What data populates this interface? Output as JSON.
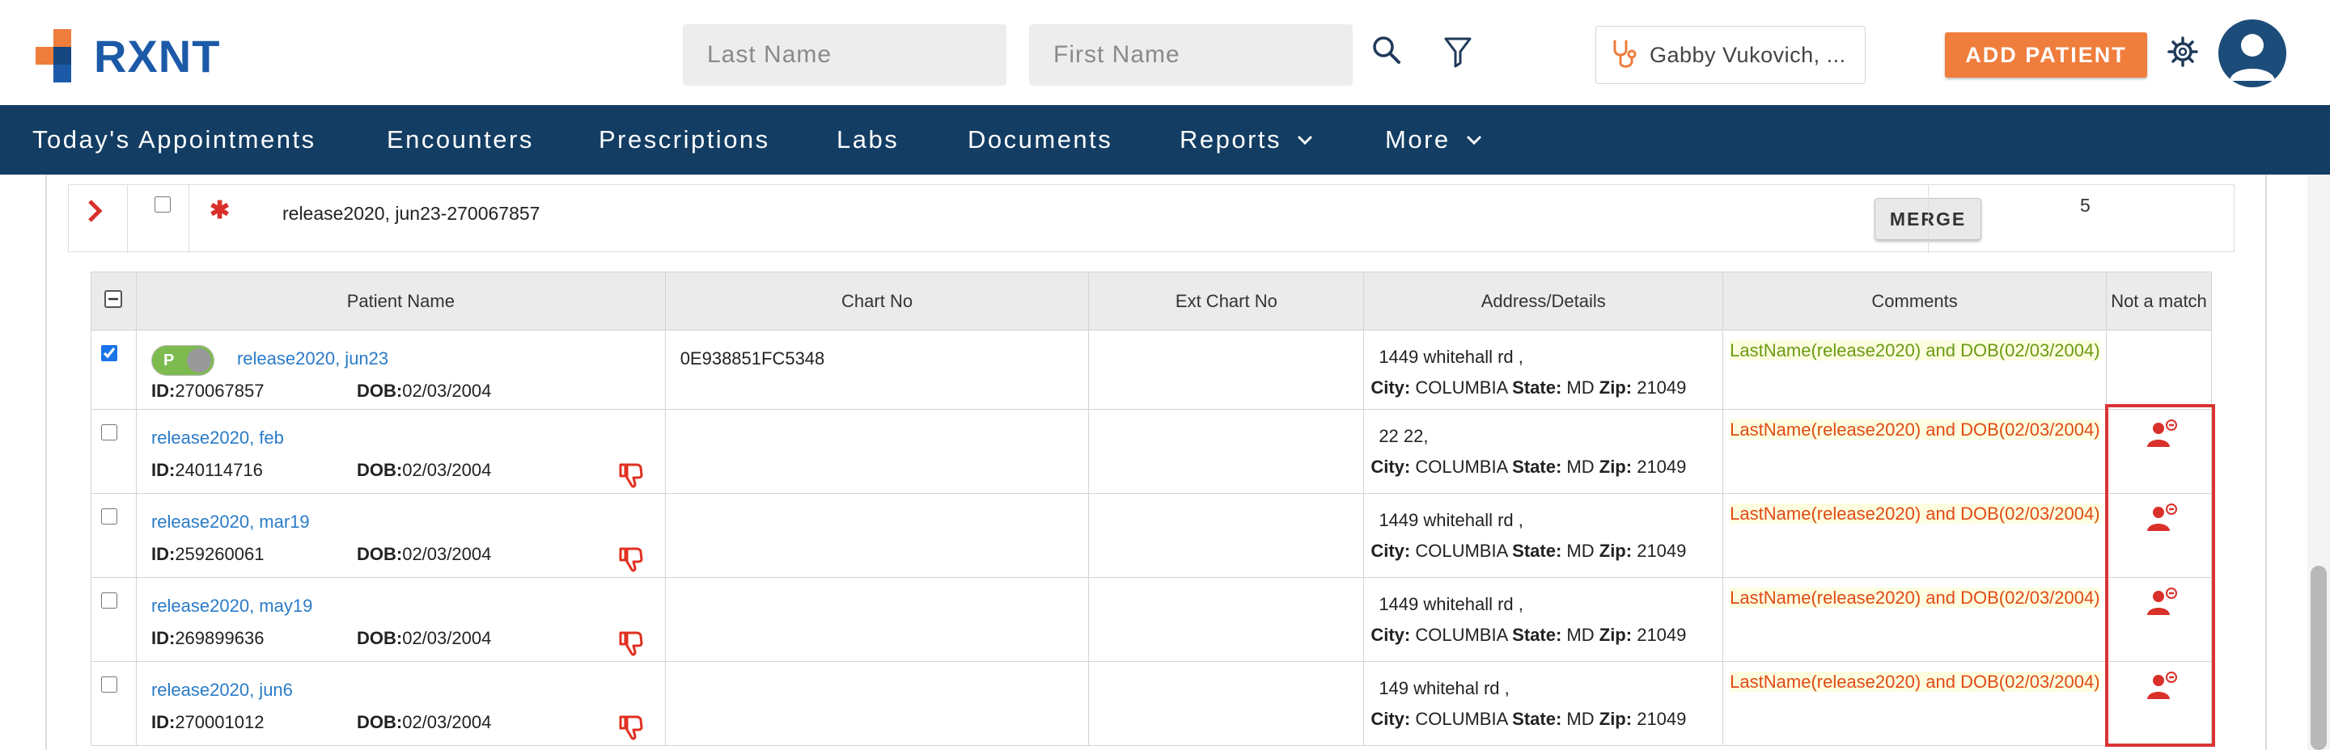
{
  "header": {
    "logo_text": "RXNT",
    "last_name_placeholder": "Last Name",
    "first_name_placeholder": "First Name",
    "provider_name": "Gabby Vukovich, ...",
    "add_patient_label": "ADD PATIENT",
    "icons": [
      "search-icon",
      "filter-icon",
      "stethoscope-icon",
      "gear-icon",
      "user-avatar-icon"
    ]
  },
  "nav": {
    "items": [
      {
        "label": "Today's Appointments"
      },
      {
        "label": "Encounters"
      },
      {
        "label": "Prescriptions"
      },
      {
        "label": "Labs"
      },
      {
        "label": "Documents"
      },
      {
        "label": "Reports"
      },
      {
        "label": "More"
      }
    ]
  },
  "group": {
    "name": "release2020, jun23-270067857",
    "merge_label": "MERGE",
    "count": "5"
  },
  "table": {
    "headers": {
      "patient_name": "Patient Name",
      "chart_no": "Chart No",
      "ext_chart_no": "Ext Chart No",
      "address": "Address/Details",
      "comments": "Comments",
      "not_a_match": "Not a match"
    },
    "labels": {
      "id": "ID:",
      "dob": "DOB:",
      "city": "City:",
      "state": "State:",
      "zip": "Zip:",
      "primary_toggle": "P"
    },
    "rows": [
      {
        "name": "release2020, jun23",
        "id": "270067857",
        "dob": "02/03/2004",
        "chart_no": "0E938851FC5348",
        "ext_chart_no": "",
        "address_line": "1449 whitehall rd ,",
        "city": "COLUMBIA",
        "state": "MD",
        "zip": "21049",
        "comment": "LastName(release2020) and DOB(02/03/2004)",
        "checked": true
      },
      {
        "name": "release2020, feb",
        "id": "240114716",
        "dob": "02/03/2004",
        "chart_no": "",
        "ext_chart_no": "",
        "address_line": "22 22,",
        "city": "COLUMBIA",
        "state": "MD",
        "zip": "21049",
        "comment": "LastName(release2020) and DOB(02/03/2004)",
        "checked": false
      },
      {
        "name": "release2020, mar19",
        "id": "259260061",
        "dob": "02/03/2004",
        "chart_no": "",
        "ext_chart_no": "",
        "address_line": "1449 whitehall rd ,",
        "city": "COLUMBIA",
        "state": "MD",
        "zip": "21049",
        "comment": "LastName(release2020) and DOB(02/03/2004)",
        "checked": false
      },
      {
        "name": "release2020, may19",
        "id": "269899636",
        "dob": "02/03/2004",
        "chart_no": "",
        "ext_chart_no": "",
        "address_line": "1449 whitehall rd ,",
        "city": "COLUMBIA",
        "state": "MD",
        "zip": "21049",
        "comment": "LastName(release2020) and DOB(02/03/2004)",
        "checked": false
      },
      {
        "name": "release2020, jun6",
        "id": "270001012",
        "dob": "02/03/2004",
        "chart_no": "",
        "ext_chart_no": "",
        "address_line": "149 whitehal rd ,",
        "city": "COLUMBIA",
        "state": "MD",
        "zip": "21049",
        "comment": "LastName(release2020) and DOB(02/03/2004)",
        "checked": false
      }
    ]
  },
  "colors": {
    "brand_blue": "#1c5aa8",
    "brand_orange": "#ef7d3c",
    "nav_bg": "#133d63",
    "link_blue": "#2a7bc8",
    "match_green": "#6a9a12",
    "mismatch_orange": "#e24a14",
    "alert_red": "#d9302a"
  }
}
